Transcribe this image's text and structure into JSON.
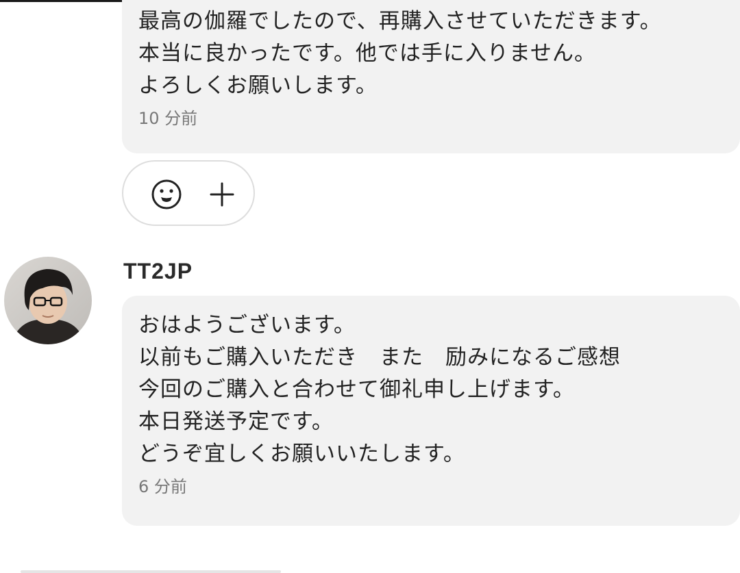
{
  "messages": [
    {
      "sender": "",
      "lines": [
        "最高の伽羅でしたので、再購入させていただきます。",
        "本当に良かったです。他では手に入りません。",
        "よろしくお願いします。"
      ],
      "time": "10 分前"
    },
    {
      "sender": "TT2JP",
      "lines": [
        "おはようございます。",
        "以前もご購入いただき　また　励みになるご感想",
        "今回のご購入と合わせて御礼申し上げます。",
        "本日発送予定です。",
        "どうぞ宜しくお願いいたします。"
      ],
      "time": "6 分前"
    }
  ],
  "reactions": {
    "icons": [
      "smiley-face-icon",
      "plus-icon"
    ]
  },
  "colors": {
    "bubble_bg": "#f2f2f2",
    "text": "#222222",
    "timestamp": "#777777",
    "pill_border": "#dddddd"
  }
}
